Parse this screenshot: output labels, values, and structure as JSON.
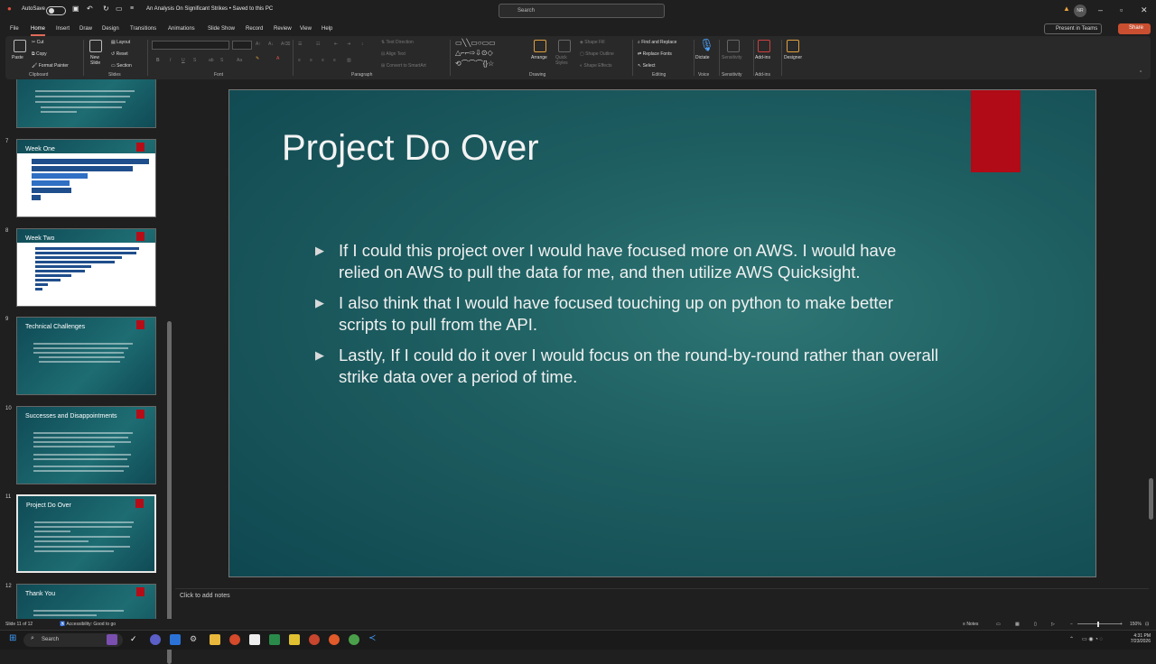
{
  "titlebar": {
    "autosave_label": "AutoSave",
    "autosave_state": "Off",
    "doc_title": "An Analysis On Significant Strikes",
    "save_status": "Saved to this PC",
    "search_placeholder": "Search",
    "user_initials": "NR"
  },
  "menu": {
    "items": [
      "File",
      "Home",
      "Insert",
      "Draw",
      "Design",
      "Transitions",
      "Animations",
      "Slide Show",
      "Record",
      "Review",
      "View",
      "Help"
    ],
    "present_label": "Present in Teams",
    "share_label": "Share"
  },
  "ribbon": {
    "clipboard": {
      "paste": "Paste",
      "cut": "Cut",
      "copy": "Copy",
      "format_painter": "Format Painter",
      "group": "Clipboard"
    },
    "slides": {
      "new_slide": "New Slide",
      "layout": "Layout",
      "reset": "Reset",
      "section": "Section",
      "group": "Slides"
    },
    "font": {
      "group": "Font",
      "bold": "B",
      "italic": "I",
      "underline": "U",
      "strike": "S"
    },
    "paragraph": {
      "group": "Paragraph",
      "text_direction": "Text Direction",
      "align_text": "Align Text",
      "smartart": "Convert to SmartArt"
    },
    "drawing": {
      "group": "Drawing",
      "arrange": "Arrange",
      "quick_styles": "Quick Styles",
      "shape_fill": "Shape Fill",
      "shape_outline": "Shape Outline",
      "shape_effects": "Shape Effects"
    },
    "editing": {
      "group": "Editing",
      "find_replace": "Find and Replace",
      "replace_fonts": "Replace Fonts",
      "select": "Select"
    },
    "voice": {
      "group": "Voice",
      "dictate": "Dictate"
    },
    "sensitivity": {
      "group": "Sensitivity",
      "label": "Sensitivity"
    },
    "addins": {
      "group": "Add-ins",
      "label": "Add-ins"
    },
    "designer": {
      "label": "Designer"
    }
  },
  "thumbnails": [
    {
      "num": "7",
      "title": "Week One"
    },
    {
      "num": "8",
      "title": "Week Two"
    },
    {
      "num": "9",
      "title": "Technical Challenges"
    },
    {
      "num": "10",
      "title": "Successes and Disappointments"
    },
    {
      "num": "11",
      "title": "Project Do Over"
    },
    {
      "num": "12",
      "title": "Thank You"
    }
  ],
  "slide": {
    "title": "Project Do Over",
    "bullets": [
      "If I could this project over I would have focused more on AWS. I would have relied on AWS to pull the data for me, and then utilize AWS Quicksight.",
      "I also think that I would have focused touching up on python to make better scripts to pull from the API.",
      "Lastly, If I could do it over I would focus on the round-by-round rather than overall strike data over a period of time."
    ]
  },
  "notes_placeholder": "Click to add notes",
  "status": {
    "slide_count": "Slide 11 of 12",
    "accessibility": "Accessibility: Good to go",
    "notes": "Notes",
    "zoom": "150%"
  },
  "taskbar": {
    "search": "Search",
    "time": "4:31 PM",
    "date": "7/23/2026"
  }
}
